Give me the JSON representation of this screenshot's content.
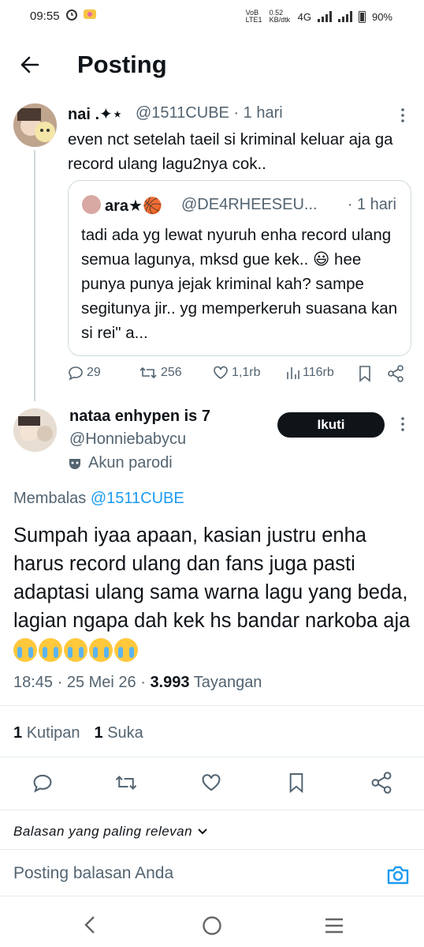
{
  "status_bar": {
    "time": "09:55",
    "carrier": "VoB LTE1",
    "speed": "0.52 KB/dtk",
    "network": "4G",
    "battery": "90%"
  },
  "header": {
    "title": "Posting"
  },
  "parent_post": {
    "name": "nai .✦⋆",
    "handle": "@1511CUBE · 1 hari",
    "text": "even nct setelah taeil si kriminal keluar aja ga record ulang lagu2nya cok..",
    "quote": {
      "name": "ara★🏀",
      "handle": "@DE4RHEESEU...",
      "time": "· 1 hari",
      "text": "tadi ada yg lewat nyuruh enha record ulang semua lagunya, mksd gue kek.. 😃 hee punya punya jejak kriminal kah? sampe segitunya jir.. yg memperkeruh suasana kan si rei\" a..."
    },
    "actions": {
      "replies": "29",
      "reposts": "256",
      "likes": "1,1rb",
      "views": "116rb"
    }
  },
  "main_post": {
    "name": "nataa enhypen is 7",
    "handle": "@Honniebabycu",
    "follow_label": "Ikuti",
    "parody_label": "Akun parodi",
    "replying_prefix": "Membalas ",
    "replying_mention": "@1511CUBE",
    "text": "Sumpah iyaa apaan, kasian justru enha harus record ulang dan fans juga pasti adaptasi ulang sama warna lagu yang beda, lagian ngapa dah kek hs bandar narkoba aja",
    "time": "18:45 · 25 Mei 26 · ",
    "views_count": "3.993",
    "views_label": " Tayangan",
    "quotes_count": "1",
    "quotes_label": "Kutipan",
    "likes_count": "1",
    "likes_label": "Suka"
  },
  "sort_label": "Balasan yang paling relevan",
  "reply_placeholder": "Posting balasan Anda",
  "colors": {
    "accent": "#1d9bf0",
    "text": "#0f1419",
    "muted": "#536471"
  },
  "icons": [
    "back-arrow-icon",
    "more-icon",
    "reply-icon",
    "repost-icon",
    "like-icon",
    "views-icon",
    "bookmark-icon",
    "share-icon",
    "camera-icon",
    "parody-mask-icon",
    "chevron-down-icon"
  ]
}
